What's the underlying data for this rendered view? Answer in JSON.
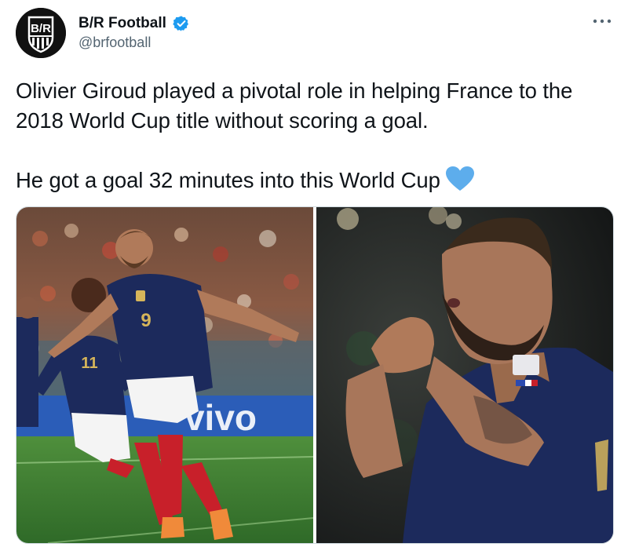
{
  "author": {
    "display_name": "B/R Football",
    "handle": "@brfootball",
    "avatar_text": "B/R",
    "verified": true
  },
  "tweet": {
    "paragraph_1": "Olivier Giroud played a pivotal role in helping France to the 2018 World Cup title without scoring a goal.",
    "paragraph_2": "He got a goal 32 minutes into this World Cup",
    "emoji": "blue-heart-icon"
  },
  "media": {
    "left_photo": {
      "shirt_numbers": [
        "9",
        "11"
      ],
      "banner_text": "vivo"
    },
    "right_photo": {}
  },
  "colors": {
    "text": "#0f1419",
    "secondary_text": "#536471",
    "verified_blue": "#1d9bf0",
    "heart_blue": "#5dadec",
    "france_navy": "#1c2a5c",
    "pitch_green": "#3d7f32",
    "sock_red": "#c8202a"
  }
}
